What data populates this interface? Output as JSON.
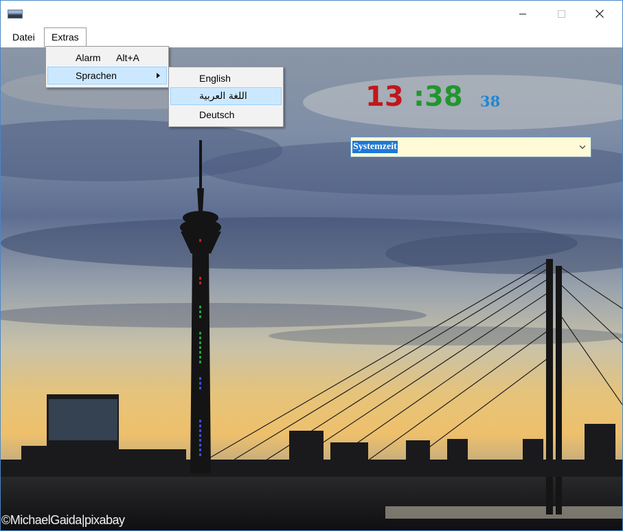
{
  "window": {
    "icon": "app-icon",
    "controls": {
      "minimize": "minimize-icon",
      "maximize": "maximize-icon",
      "close": "close-icon"
    }
  },
  "menubar": {
    "items": [
      {
        "label": "Datei"
      },
      {
        "label": "Extras"
      }
    ]
  },
  "extras_menu": {
    "items": [
      {
        "label": "Alarm",
        "shortcut": "Alt+A"
      },
      {
        "label": "Sprachen",
        "has_submenu": true
      }
    ]
  },
  "language_submenu": {
    "items": [
      {
        "label": "English"
      },
      {
        "label": "اللغة العربية"
      },
      {
        "label": "Deutsch"
      }
    ],
    "highlighted_index": 1
  },
  "clock": {
    "hours": "13",
    "separator_minutes": ":38",
    "seconds": "38",
    "colors": {
      "hours": "#c0171c",
      "minutes": "#22962e",
      "seconds": "#1e86d6"
    }
  },
  "time_source_select": {
    "value": "Systemzeit"
  },
  "background": {
    "credit": "©MichaelGaida|pixabay"
  }
}
